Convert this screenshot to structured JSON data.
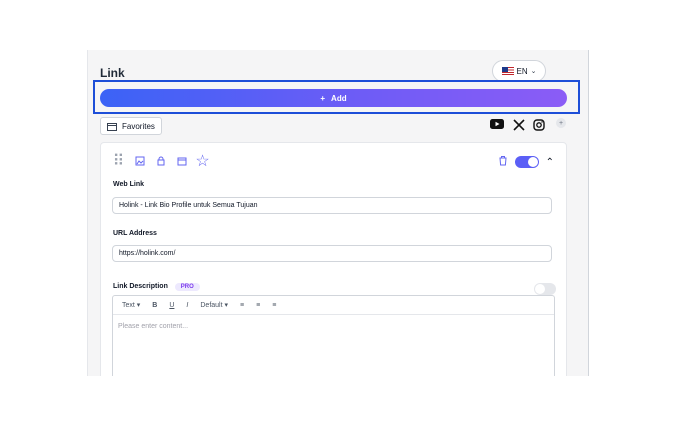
{
  "header": {
    "title": "Link",
    "language": "EN"
  },
  "actions": {
    "add_label": "Add",
    "favorites_label": "Favorites"
  },
  "social_icons": [
    "youtube-icon",
    "x-icon",
    "instagram-icon",
    "plus-icon"
  ],
  "card": {
    "web_link": {
      "label": "Web Link",
      "value": "Holink - Link Bio Profile untuk Semua Tujuan"
    },
    "url": {
      "label": "URL Address",
      "value": "https://holink.com/"
    },
    "description": {
      "label": "Link Description",
      "badge": "PRO",
      "placeholder": "Please enter content..."
    },
    "editor_tools": {
      "text": "Text ▾",
      "bold": "B",
      "underline": "U",
      "italic": "I",
      "size": "Default ▾",
      "align_left": "≡",
      "align_center": "≡",
      "align_right": "≡"
    }
  },
  "colors": {
    "accent": "#5b5ff6",
    "gradient_start": "#3b63f6",
    "gradient_end": "#8b5cf6",
    "highlight_border": "#1d4ed8"
  }
}
